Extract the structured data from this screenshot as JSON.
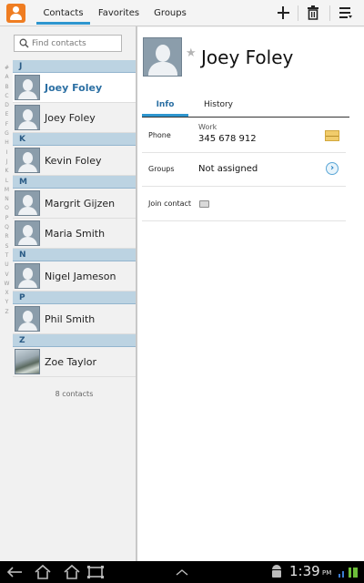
{
  "tabs": [
    "Contacts",
    "Favorites",
    "Groups"
  ],
  "search": {
    "placeholder": "Find contacts"
  },
  "alphabet": [
    "#",
    "A",
    "B",
    "C",
    "D",
    "E",
    "F",
    "G",
    "H",
    "I",
    "J",
    "K",
    "L",
    "M",
    "N",
    "O",
    "P",
    "Q",
    "R",
    "S",
    "T",
    "U",
    "V",
    "W",
    "X",
    "Y",
    "Z"
  ],
  "list": {
    "sections": [
      {
        "letter": "J",
        "contacts": [
          {
            "name": "Joey Foley",
            "selected": true
          },
          {
            "name": "Joey Foley"
          }
        ]
      },
      {
        "letter": "K",
        "contacts": [
          {
            "name": "Kevin Foley"
          }
        ]
      },
      {
        "letter": "M",
        "contacts": [
          {
            "name": "Margrit Gijzen"
          },
          {
            "name": "Maria Smith"
          }
        ]
      },
      {
        "letter": "N",
        "contacts": [
          {
            "name": "Nigel Jameson"
          }
        ]
      },
      {
        "letter": "P",
        "contacts": [
          {
            "name": "Phil Smith"
          }
        ]
      },
      {
        "letter": "Z",
        "contacts": [
          {
            "name": "Zoe Taylor",
            "photo": true
          }
        ]
      }
    ],
    "count": "8 contacts"
  },
  "detail": {
    "name": "Joey Foley",
    "tabs": {
      "info": "Info",
      "history": "History"
    },
    "phone": {
      "label": "Phone",
      "type": "Work",
      "number": "345 678 912"
    },
    "groups": {
      "label": "Groups",
      "value": "Not assigned"
    },
    "join": {
      "label": "Join contact"
    }
  },
  "status": {
    "time": "1:39",
    "ampm": "PM"
  },
  "icons": {
    "app": "contacts-app-icon",
    "add": "add-icon",
    "delete": "trash-icon",
    "menu": "menu-icon",
    "search": "search-icon",
    "star": "star-icon",
    "message": "envelope-icon",
    "groups": "chevron-right-icon",
    "join": "join-icon",
    "nav": [
      "back-icon",
      "home-icon",
      "recent-apps-icon",
      "up-arrow-icon"
    ],
    "notify": [
      "android-icon",
      "signal-icon"
    ]
  },
  "colors": {
    "accent": "#2e96cf",
    "selected_text": "#2b6fa3",
    "section_header": "#bcd3e2",
    "app_icon": "#ef7d22"
  }
}
